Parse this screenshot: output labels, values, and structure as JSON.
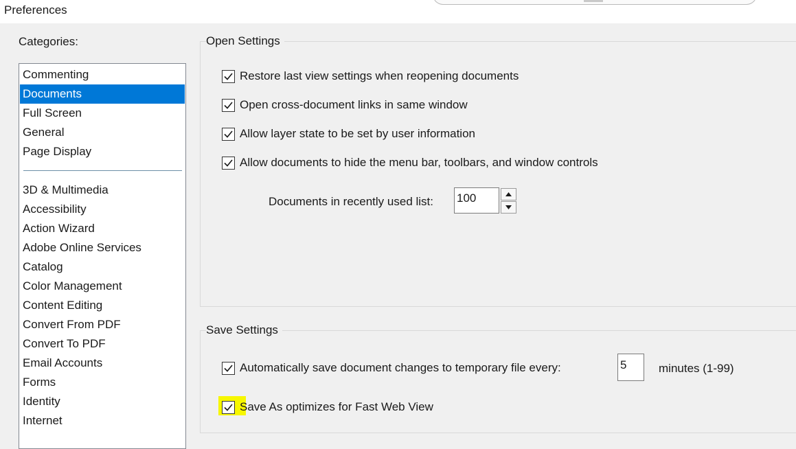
{
  "window": {
    "title": "Preferences"
  },
  "categories": {
    "label": "Categories:",
    "top_items": [
      "Commenting",
      "Documents",
      "Full Screen",
      "General",
      "Page Display"
    ],
    "bottom_items": [
      "3D & Multimedia",
      "Accessibility",
      "Action Wizard",
      "Adobe Online Services",
      "Catalog",
      "Color Management",
      "Content Editing",
      "Convert From PDF",
      "Convert To PDF",
      "Email Accounts",
      "Forms",
      "Identity",
      "Internet"
    ],
    "selected": "Documents"
  },
  "open_settings": {
    "title": "Open Settings",
    "options": [
      {
        "label": "Restore last view settings when reopening documents",
        "checked": true
      },
      {
        "label": "Open cross-document links in same window",
        "checked": true
      },
      {
        "label": "Allow layer state to be set by user information",
        "checked": true
      },
      {
        "label": "Allow documents to hide the menu bar, toolbars, and window controls",
        "checked": true
      }
    ],
    "recent_list": {
      "label": "Documents in recently used list:",
      "value": "100"
    }
  },
  "save_settings": {
    "title": "Save Settings",
    "autosave": {
      "label": "Automatically save document changes to temporary file every:",
      "checked": true,
      "value": "5",
      "unit_label": "minutes (1-99)"
    },
    "fast_web_view": {
      "label": "Save As optimizes for Fast Web View",
      "checked": true,
      "highlight_color": "#f7f700"
    }
  },
  "colors": {
    "selection": "#0078d7",
    "dialog_background": "#f0f0f0"
  },
  "icons": {
    "check": "checkmark-icon",
    "spin_up": "arrow-up-icon",
    "spin_down": "arrow-down-icon"
  }
}
